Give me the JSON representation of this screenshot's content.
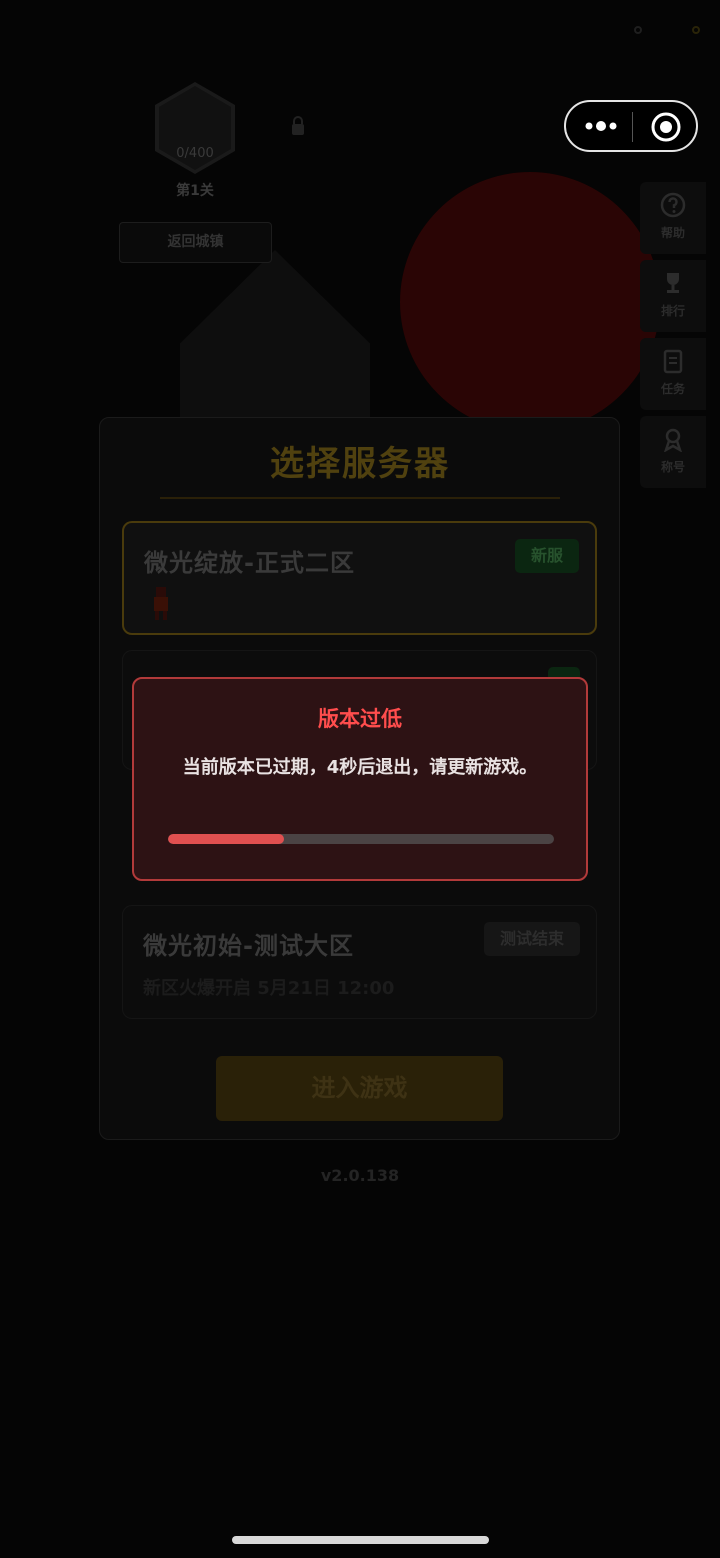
{
  "background": {
    "level_progress": "0/400",
    "level_label": "第1关",
    "back_button": "返回城镇",
    "side_menu": [
      {
        "label": "帮助",
        "icon": "help-icon"
      },
      {
        "label": "排行",
        "icon": "trophy-icon"
      },
      {
        "label": "任务",
        "icon": "task-icon"
      },
      {
        "label": "称号",
        "icon": "badge-icon"
      }
    ]
  },
  "capsule": {
    "more_icon": "more-dots-icon",
    "close_icon": "target-close-icon"
  },
  "server_panel": {
    "title": "选择服务器",
    "servers": [
      {
        "name": "微光绽放-正式二区",
        "badge": "新服",
        "subtitle": ""
      },
      {
        "name": "微光初始-测试大区",
        "badge": "测试结束",
        "subtitle": "新区火爆开启 5月21日 12:00"
      }
    ],
    "enter_button": "进入游戏",
    "version": "v2.0.138"
  },
  "alert": {
    "title": "版本过低",
    "message": "当前版本已过期，4秒后退出，请更新游戏。",
    "progress": 0.3
  },
  "colors": {
    "alert_border": "#b23a3a",
    "alert_title": "#ff4d4d",
    "progress_fill": "#e05050"
  }
}
